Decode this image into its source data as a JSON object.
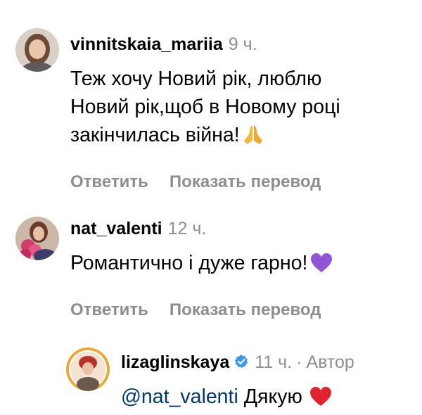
{
  "comments": [
    {
      "username": "vinnitskaia_mariia",
      "time": "9 ч.",
      "text_lines": [
        "Теж хочу Новий рік, люблю",
        "Новий рік,щоб в Новому році",
        "закінчилась війна!"
      ],
      "emoji": "praying-hands",
      "reply_label": "Ответить",
      "translate_label": "Показать перевод"
    },
    {
      "username": "nat_valenti",
      "time": "12 ч.",
      "text_lines": [
        "Романтично і дуже гарно!"
      ],
      "emoji": "purple-heart",
      "reply_label": "Ответить",
      "translate_label": "Показать перевод"
    },
    {
      "username": "lizaglinskaya",
      "verified": true,
      "time": "11 ч.",
      "separator": "·",
      "author_label": "Автор",
      "mention": "@nat_valenti",
      "text": "Дякую",
      "emoji": "red-heart"
    }
  ],
  "colors": {
    "secondary_text": "#8e8e8e",
    "mention": "#00376b",
    "verified": "#3897f0",
    "purple_heart": "#8f55d6",
    "red_heart": "#e0232e",
    "praying_hands": "#f5b83d"
  }
}
